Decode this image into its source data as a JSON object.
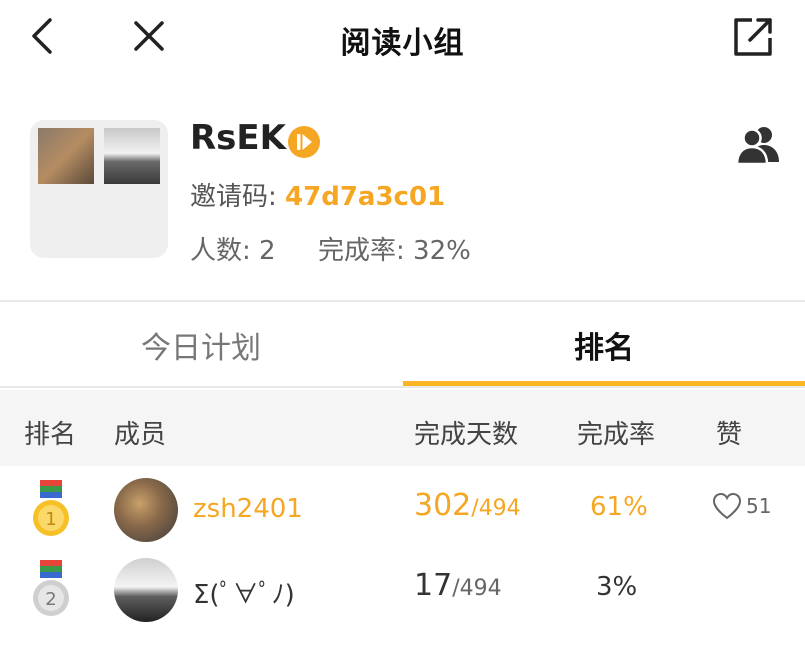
{
  "nav": {
    "title": "阅读小组"
  },
  "group": {
    "name": "RsEK",
    "invite_label": "邀请码: ",
    "invite_code": "47d7a3c01",
    "count_label": "人数: 2",
    "rate_label": "完成率: 32%"
  },
  "tabs": [
    {
      "label": "今日计划",
      "active": false
    },
    {
      "label": "排名",
      "active": true
    }
  ],
  "table": {
    "headers": {
      "rank": "排名",
      "member": "成员",
      "days": "完成天数",
      "rate": "完成率",
      "like": "赞"
    },
    "rows": [
      {
        "rank": "1",
        "name": "zsh2401",
        "done": "302",
        "sep": "/",
        "total": "494",
        "rate": "61%",
        "likes": "51",
        "highlight": true
      },
      {
        "rank": "2",
        "name": "Σ(ﾟ∀ﾟﾉ)",
        "done": "17",
        "sep": "/",
        "total": "494",
        "rate": "3%",
        "likes": "",
        "highlight": false
      }
    ]
  },
  "colors": {
    "accent": "#f5a623",
    "tab_indicator": "#fbb424",
    "header_bg": "#f5f5f5"
  },
  "icons": [
    "back-icon",
    "close-icon",
    "share-icon",
    "vip-badge-icon",
    "members-icon",
    "gold-medal-icon",
    "silver-medal-icon",
    "heart-icon"
  ]
}
